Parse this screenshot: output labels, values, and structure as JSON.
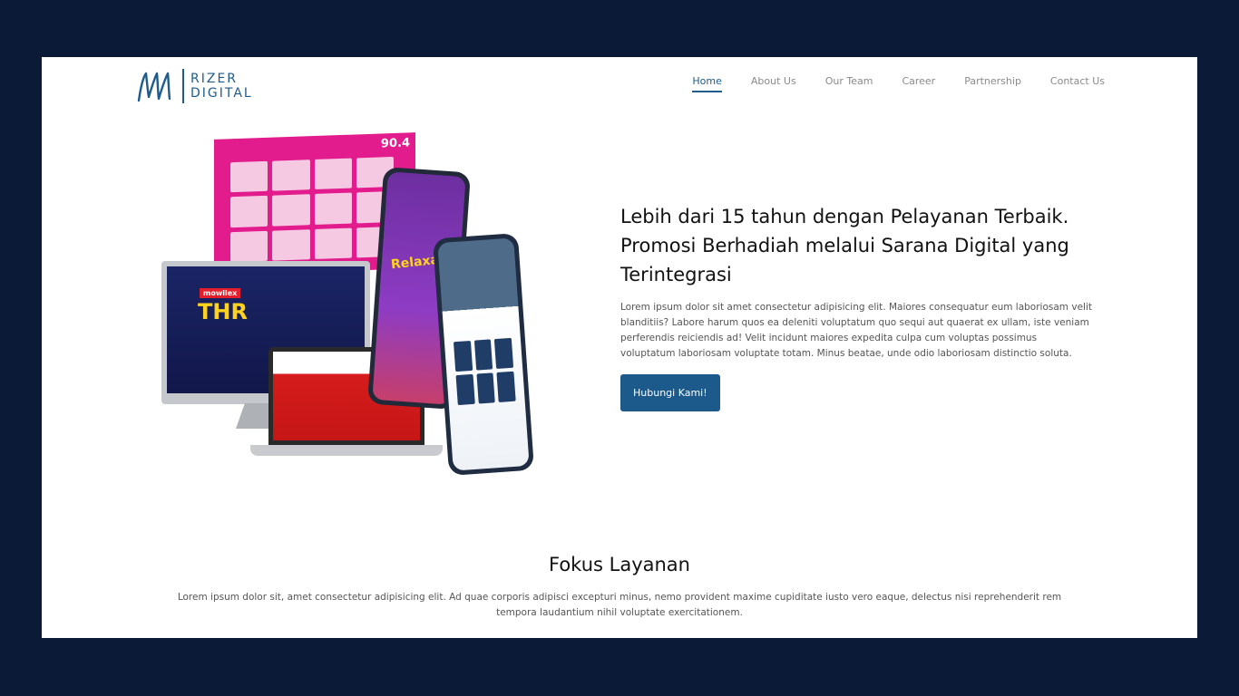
{
  "brand": {
    "line1": "RIZER",
    "line2": "DIGITAL",
    "color": "#1f5c8c"
  },
  "nav": {
    "items": [
      {
        "label": "Home",
        "active": true
      },
      {
        "label": "About Us",
        "active": false
      },
      {
        "label": "Our Team",
        "active": false
      },
      {
        "label": "Career",
        "active": false
      },
      {
        "label": "Partnership",
        "active": false
      },
      {
        "label": "Contact Us",
        "active": false
      }
    ]
  },
  "hero": {
    "title": "Lebih dari 15 tahun dengan Pelayanan Terbaik. Promosi Berhadiah melalui Sarana Digital yang Terintegrasi",
    "body": "Lorem ipsum dolor sit amet consectetur adipisicing elit. Maiores consequatur eum laboriosam velit blanditiis? Labore harum quos ea deleniti voluptatum quo sequi aut quaerat ex ullam, iste veniam perferendis reiciendis ad! Velit incidunt maiores expedita culpa cum voluptas possimus voluptatum laboriosam voluptate totam. Minus beatae, unde odio laboriosam distinctio soluta.",
    "cta_label": "Hubungi Kami!",
    "art": {
      "poster_badge": "90.4",
      "monitor_brand": "mowilex",
      "monitor_headline": "THR",
      "phone_headline": "Relaxa"
    }
  },
  "focus": {
    "title": "Fokus Layanan",
    "body": "Lorem ipsum dolor sit, amet consectetur adipisicing elit. Ad quae corporis adipisci excepturi minus, nemo provident maxime cupiditate iusto vero eaque, delectus nisi reprehenderit rem tempora laudantium nihil voluptate exercitationem."
  },
  "colors": {
    "page_bg": "#0b1a36",
    "accent": "#1c5a8c",
    "nav_inactive": "#8a8a8a"
  }
}
